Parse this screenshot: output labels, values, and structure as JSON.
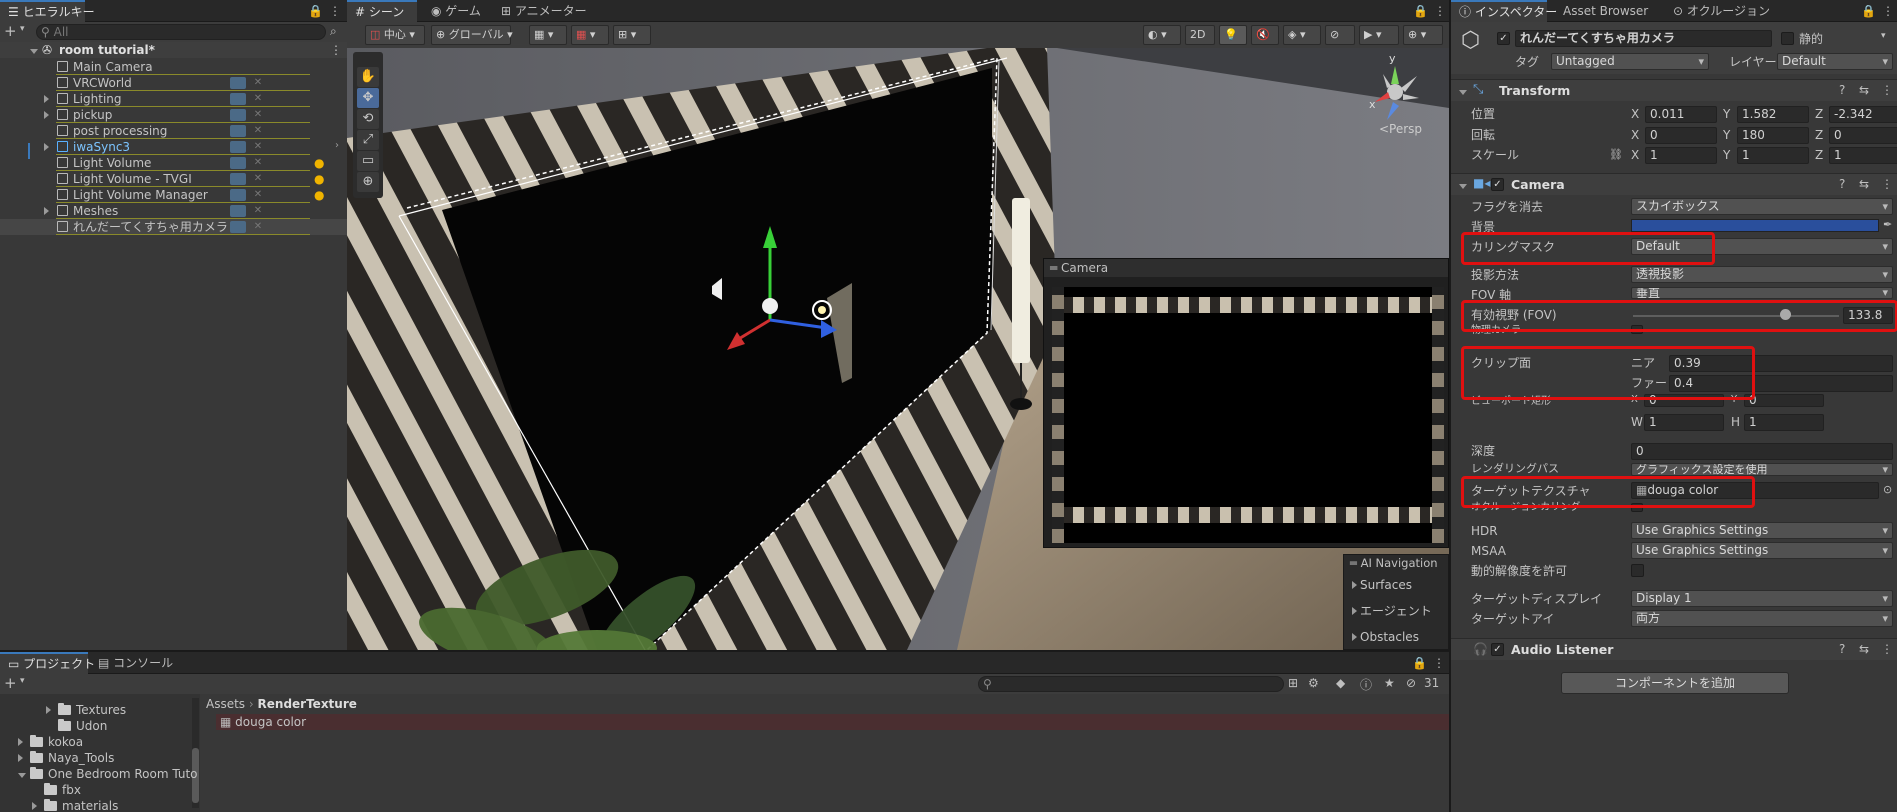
{
  "hierarchy": {
    "tab": "ヒエラルキー",
    "add": "+",
    "search_placeholder": "All",
    "scene": "room tutorial*",
    "items": [
      {
        "label": "Main Camera",
        "expandable": false,
        "prefab": false
      },
      {
        "label": "VRCWorld",
        "expandable": false,
        "prefab": false
      },
      {
        "label": "Lighting",
        "expandable": true,
        "prefab": false
      },
      {
        "label": "pickup",
        "expandable": true,
        "prefab": false
      },
      {
        "label": "post processing",
        "expandable": false,
        "prefab": false
      },
      {
        "label": "iwaSync3",
        "expandable": true,
        "prefab": true
      },
      {
        "label": "Light Volume",
        "expandable": false,
        "prefab": false
      },
      {
        "label": "Light Volume - TVGI",
        "expandable": false,
        "prefab": false
      },
      {
        "label": "Light Volume Manager",
        "expandable": false,
        "prefab": false
      },
      {
        "label": "Meshes",
        "expandable": true,
        "prefab": false
      },
      {
        "label": "れんだーてくすちゃ用カメラ",
        "expandable": false,
        "prefab": false
      }
    ]
  },
  "scene_view": {
    "tabs": [
      "シーン",
      "ゲーム",
      "アニメーター"
    ],
    "pivot": "中心",
    "space": "グローバル",
    "mode_2d": "2D",
    "persp": "<Persp",
    "gizmo_y": "y",
    "gizmo_x": "x",
    "camera_preview_title": "Camera",
    "ai_nav": {
      "title": "AI Navigation",
      "items": [
        "Surfaces",
        "エージェント",
        "Obstacles"
      ]
    }
  },
  "project": {
    "tabs": [
      "プロジェクト",
      "コンソール"
    ],
    "add": "+",
    "count": "31",
    "tree": [
      {
        "label": "Textures",
        "indent": 3,
        "expandable": true
      },
      {
        "label": "Udon",
        "indent": 3,
        "expandable": false
      },
      {
        "label": "kokoa",
        "indent": 1,
        "expandable": true
      },
      {
        "label": "Naya_Tools",
        "indent": 1,
        "expandable": true
      },
      {
        "label": "One Bedroom Room Tuto",
        "indent": 1,
        "expandable": true
      },
      {
        "label": "fbx",
        "indent": 2,
        "expandable": false
      },
      {
        "label": "materials",
        "indent": 2,
        "expandable": true
      }
    ],
    "breadcrumb": [
      "Assets",
      "RenderTexture"
    ],
    "asset": "douga color"
  },
  "inspector": {
    "tabs": [
      "インスペクター",
      "Asset Browser",
      "オクルージョン"
    ],
    "object_name": "れんだーてくすちゃ用カメラ",
    "static_label": "静的",
    "tag_label": "タグ",
    "tag_value": "Untagged",
    "layer_label": "レイヤー",
    "layer_value": "Default",
    "transform": {
      "title": "Transform",
      "position_label": "位置",
      "rotation_label": "回転",
      "scale_label": "スケール",
      "pos": [
        "0.011",
        "1.582",
        "-2.342"
      ],
      "rot": [
        "0",
        "180",
        "0"
      ],
      "scale": [
        "1",
        "1",
        "1"
      ]
    },
    "camera": {
      "title": "Camera",
      "clear_flags_label": "フラグを消去",
      "clear_flags_value": "スカイボックス",
      "background_label": "背景",
      "background_color": "#2a4f9c",
      "culling_label": "カリングマスク",
      "culling_value": "Default",
      "projection_label": "投影方法",
      "projection_value": "透視投影",
      "fov_axis_label": "FOV 軸",
      "fov_axis_value": "垂直",
      "fov_label": "有効視野 (FOV)",
      "fov_value": "133.8",
      "fov_fraction": 0.74,
      "physical_label": "物理カメラ",
      "clip_label": "クリップ面",
      "near_label": "ニア",
      "near_value": "0.39",
      "far_label": "ファー",
      "far_value": "0.4",
      "viewport_label": "ビューポート矩形",
      "vx": "0",
      "vy": "0",
      "vw": "1",
      "vh": "1",
      "depth_label": "深度",
      "depth_value": "0",
      "render_path_label": "レンダリングパス",
      "render_path_value": "グラフィックス設定を使用",
      "target_tex_label": "ターゲットテクスチャ",
      "target_tex_value": "douga color",
      "occlusion_label": "オクルージョンカリング",
      "hdr_label": "HDR",
      "hdr_value": "Use Graphics Settings",
      "msaa_label": "MSAA",
      "msaa_value": "Use Graphics Settings",
      "dynres_label": "動的解像度を許可",
      "display_label": "ターゲットディスプレイ",
      "display_value": "Display 1",
      "eye_label": "ターゲットアイ",
      "eye_value": "両方"
    },
    "audio_listener": "Audio Listener",
    "add_component": "コンポーネントを追加"
  }
}
